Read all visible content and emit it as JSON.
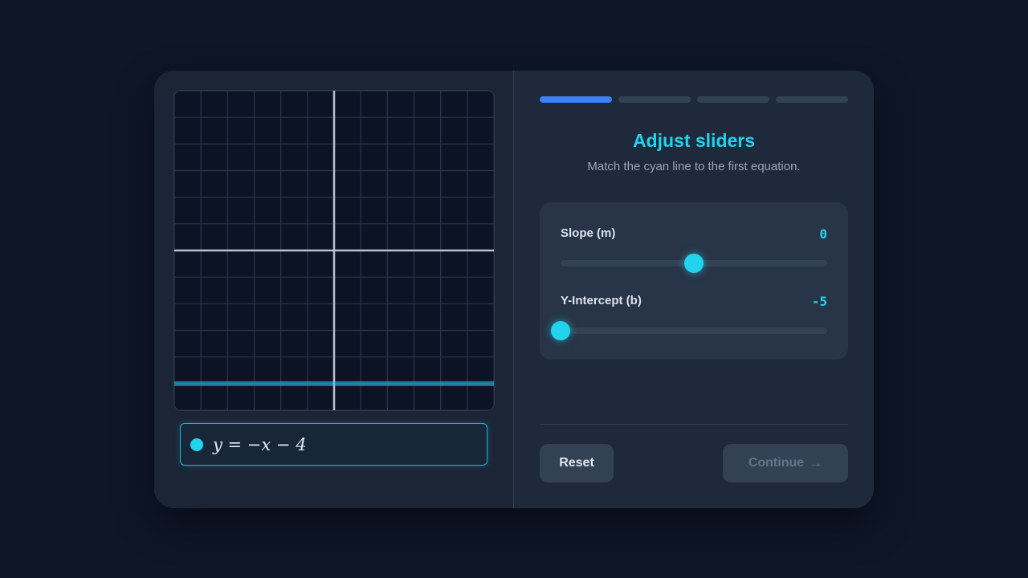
{
  "graph": {
    "range": [
      -6,
      6
    ],
    "grid_step": 1,
    "line": {
      "slope": 0,
      "intercept": -5,
      "color": "#22d3ee"
    }
  },
  "equation": {
    "text": "y = −x − 4",
    "color": "#22d3ee"
  },
  "progress": {
    "total_steps": 4,
    "current_step": 1,
    "active_color": "#3b82f6"
  },
  "step": {
    "title": "Adjust sliders",
    "subtitle": "Match the cyan line to the first equation."
  },
  "sliders": [
    {
      "label": "Slope (m)",
      "value": "0",
      "min": -5,
      "max": 5,
      "current": 0
    },
    {
      "label": "Y-Intercept (b)",
      "value": "-5",
      "min": -5,
      "max": 5,
      "current": -5
    }
  ],
  "buttons": {
    "reset_label": "Reset",
    "continue_label": "Continue",
    "continue_icon": "arrow-right-icon"
  },
  "colors": {
    "accent": "#22d3ee",
    "background": "#0e1628",
    "card": "#1b2536"
  }
}
